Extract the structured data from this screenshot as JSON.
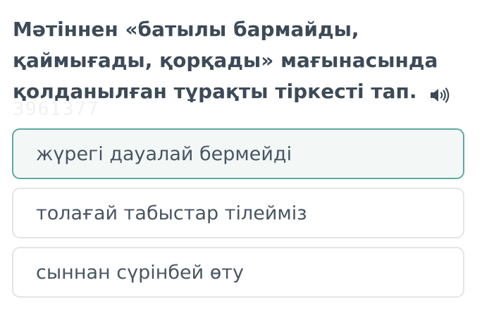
{
  "question": {
    "lines": [
      "Мәтіннен «батылы бармайды,",
      "қаймығады, қорқады» мағынасында",
      "қолданылған тұрақты тіркесті тап."
    ],
    "audio_icon": "speaker-icon",
    "watermark": "3961377"
  },
  "options": [
    {
      "label": "жүрегі дауалай бермейді",
      "selected": true
    },
    {
      "label": "толағай табыстар тілейміз",
      "selected": false
    },
    {
      "label": "сыннан сүрінбей өту",
      "selected": false
    }
  ],
  "colors": {
    "question_text": "#3d4a57",
    "option_text": "#485562",
    "selected_border": "#5fa8a0",
    "default_border": "#e3e5e8"
  }
}
